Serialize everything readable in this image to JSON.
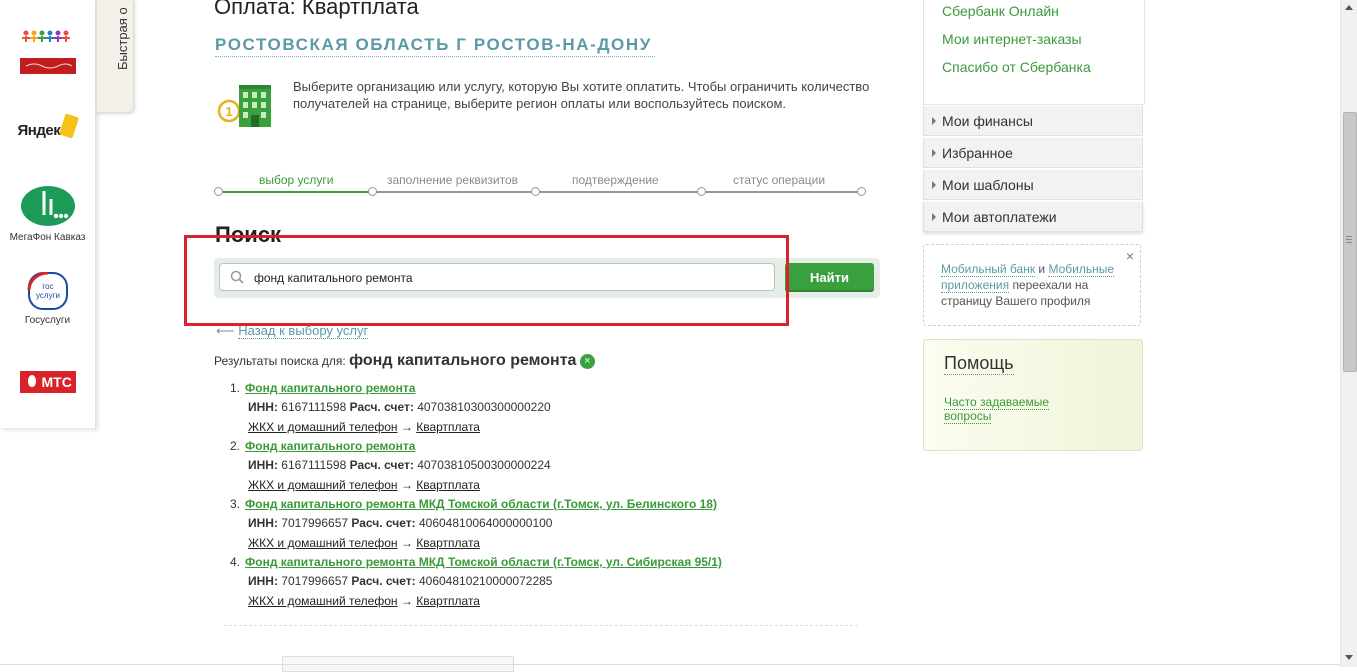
{
  "quick_pay": {
    "tab_label": "Быстрая о",
    "items": [
      {
        "label": "",
        "icon": "children-charity-logo"
      },
      {
        "label": "",
        "icon": "yandex-logo"
      },
      {
        "label": "МегаФон Кавказ",
        "icon": "megafon-logo"
      },
      {
        "label": "Госуслуги",
        "icon": "gosuslugi-logo"
      },
      {
        "label": "",
        "icon": "mts-logo"
      }
    ],
    "logo_text": {
      "yandex": "Яндекс",
      "mts": "МТС",
      "gos_line1": "гос",
      "gos_line2": "услуги"
    }
  },
  "page": {
    "title": "Оплата: Квартплата",
    "region": "РОСТОВСКАЯ ОБЛАСТЬ Г РОСТОВ-НА-ДОНУ",
    "info": "Выберите организацию или услугу, которую Вы хотите оплатить. Чтобы ограничить количество получателей на странице, выберите регион оплаты или воспользуйтесь поиском."
  },
  "steps": [
    {
      "label": "выбор услуги",
      "active": true
    },
    {
      "label": "заполнение реквизитов",
      "active": false
    },
    {
      "label": "подтверждение",
      "active": false
    },
    {
      "label": "статус операции",
      "active": false
    }
  ],
  "search": {
    "heading": "Поиск",
    "value": "фонд капитального ремонта",
    "button": "Найти",
    "back_arrow": "⟵",
    "back_label": "Назад к выбору услуг",
    "results_prefix": "Результаты поиска для:",
    "results_query": "фонд капитального ремонта",
    "clear_icon": "×"
  },
  "results": [
    {
      "num": "1.",
      "name": "Фонд капитального ремонта",
      "inn_label": "ИНН:",
      "inn": "6167111598",
      "acc_label": "Расч. счет:",
      "acc": "40703810300300000220",
      "category": "ЖКХ и домашний телефон",
      "arrow": "→",
      "service": "Квартплата"
    },
    {
      "num": "2.",
      "name": "Фонд капитального ремонта",
      "inn_label": "ИНН:",
      "inn": "6167111598",
      "acc_label": "Расч. счет:",
      "acc": "40703810500300000224",
      "category": "ЖКХ и домашний телефон",
      "arrow": "→",
      "service": "Квартплата"
    },
    {
      "num": "3.",
      "name": "Фонд капитального ремонта МКД Томской области (г.Томск, ул. Белинского 18)",
      "inn_label": "ИНН:",
      "inn": "7017996657",
      "acc_label": "Расч. счет:",
      "acc": "40604810064000000100",
      "category": "ЖКХ и домашний телефон",
      "arrow": "→",
      "service": "Квартплата"
    },
    {
      "num": "4.",
      "name": "Фонд капитального ремонта МКД Томской области (г.Томск, ул. Сибирская 95/1)",
      "inn_label": "ИНН:",
      "inn": "7017996657",
      "acc_label": "Расч. счет:",
      "acc": "40604810210000072285",
      "category": "ЖКХ и домашний телефон",
      "arrow": "→",
      "service": "Квартплата"
    }
  ],
  "right": {
    "links": [
      "Сбербанк Онлайн",
      "Мои интернет-заказы",
      "Спасибо от Сбербанка"
    ],
    "menu": [
      "Мои финансы",
      "Избранное",
      "Мои шаблоны",
      "Мои автоплатежи"
    ],
    "notice": {
      "link1": "Мобильный банк",
      "and": "и",
      "link2": "Мобильные приложения",
      "text": "переехали на страницу Вашего профиля",
      "close": "×"
    },
    "help": {
      "title": "Помощь",
      "faq": "Часто задаваемые вопросы"
    }
  },
  "colors": {
    "accent_green": "#3aa03e",
    "link_green": "#3a9a3a",
    "region_teal": "#5a9aa6",
    "highlight_red": "#d8232a"
  }
}
